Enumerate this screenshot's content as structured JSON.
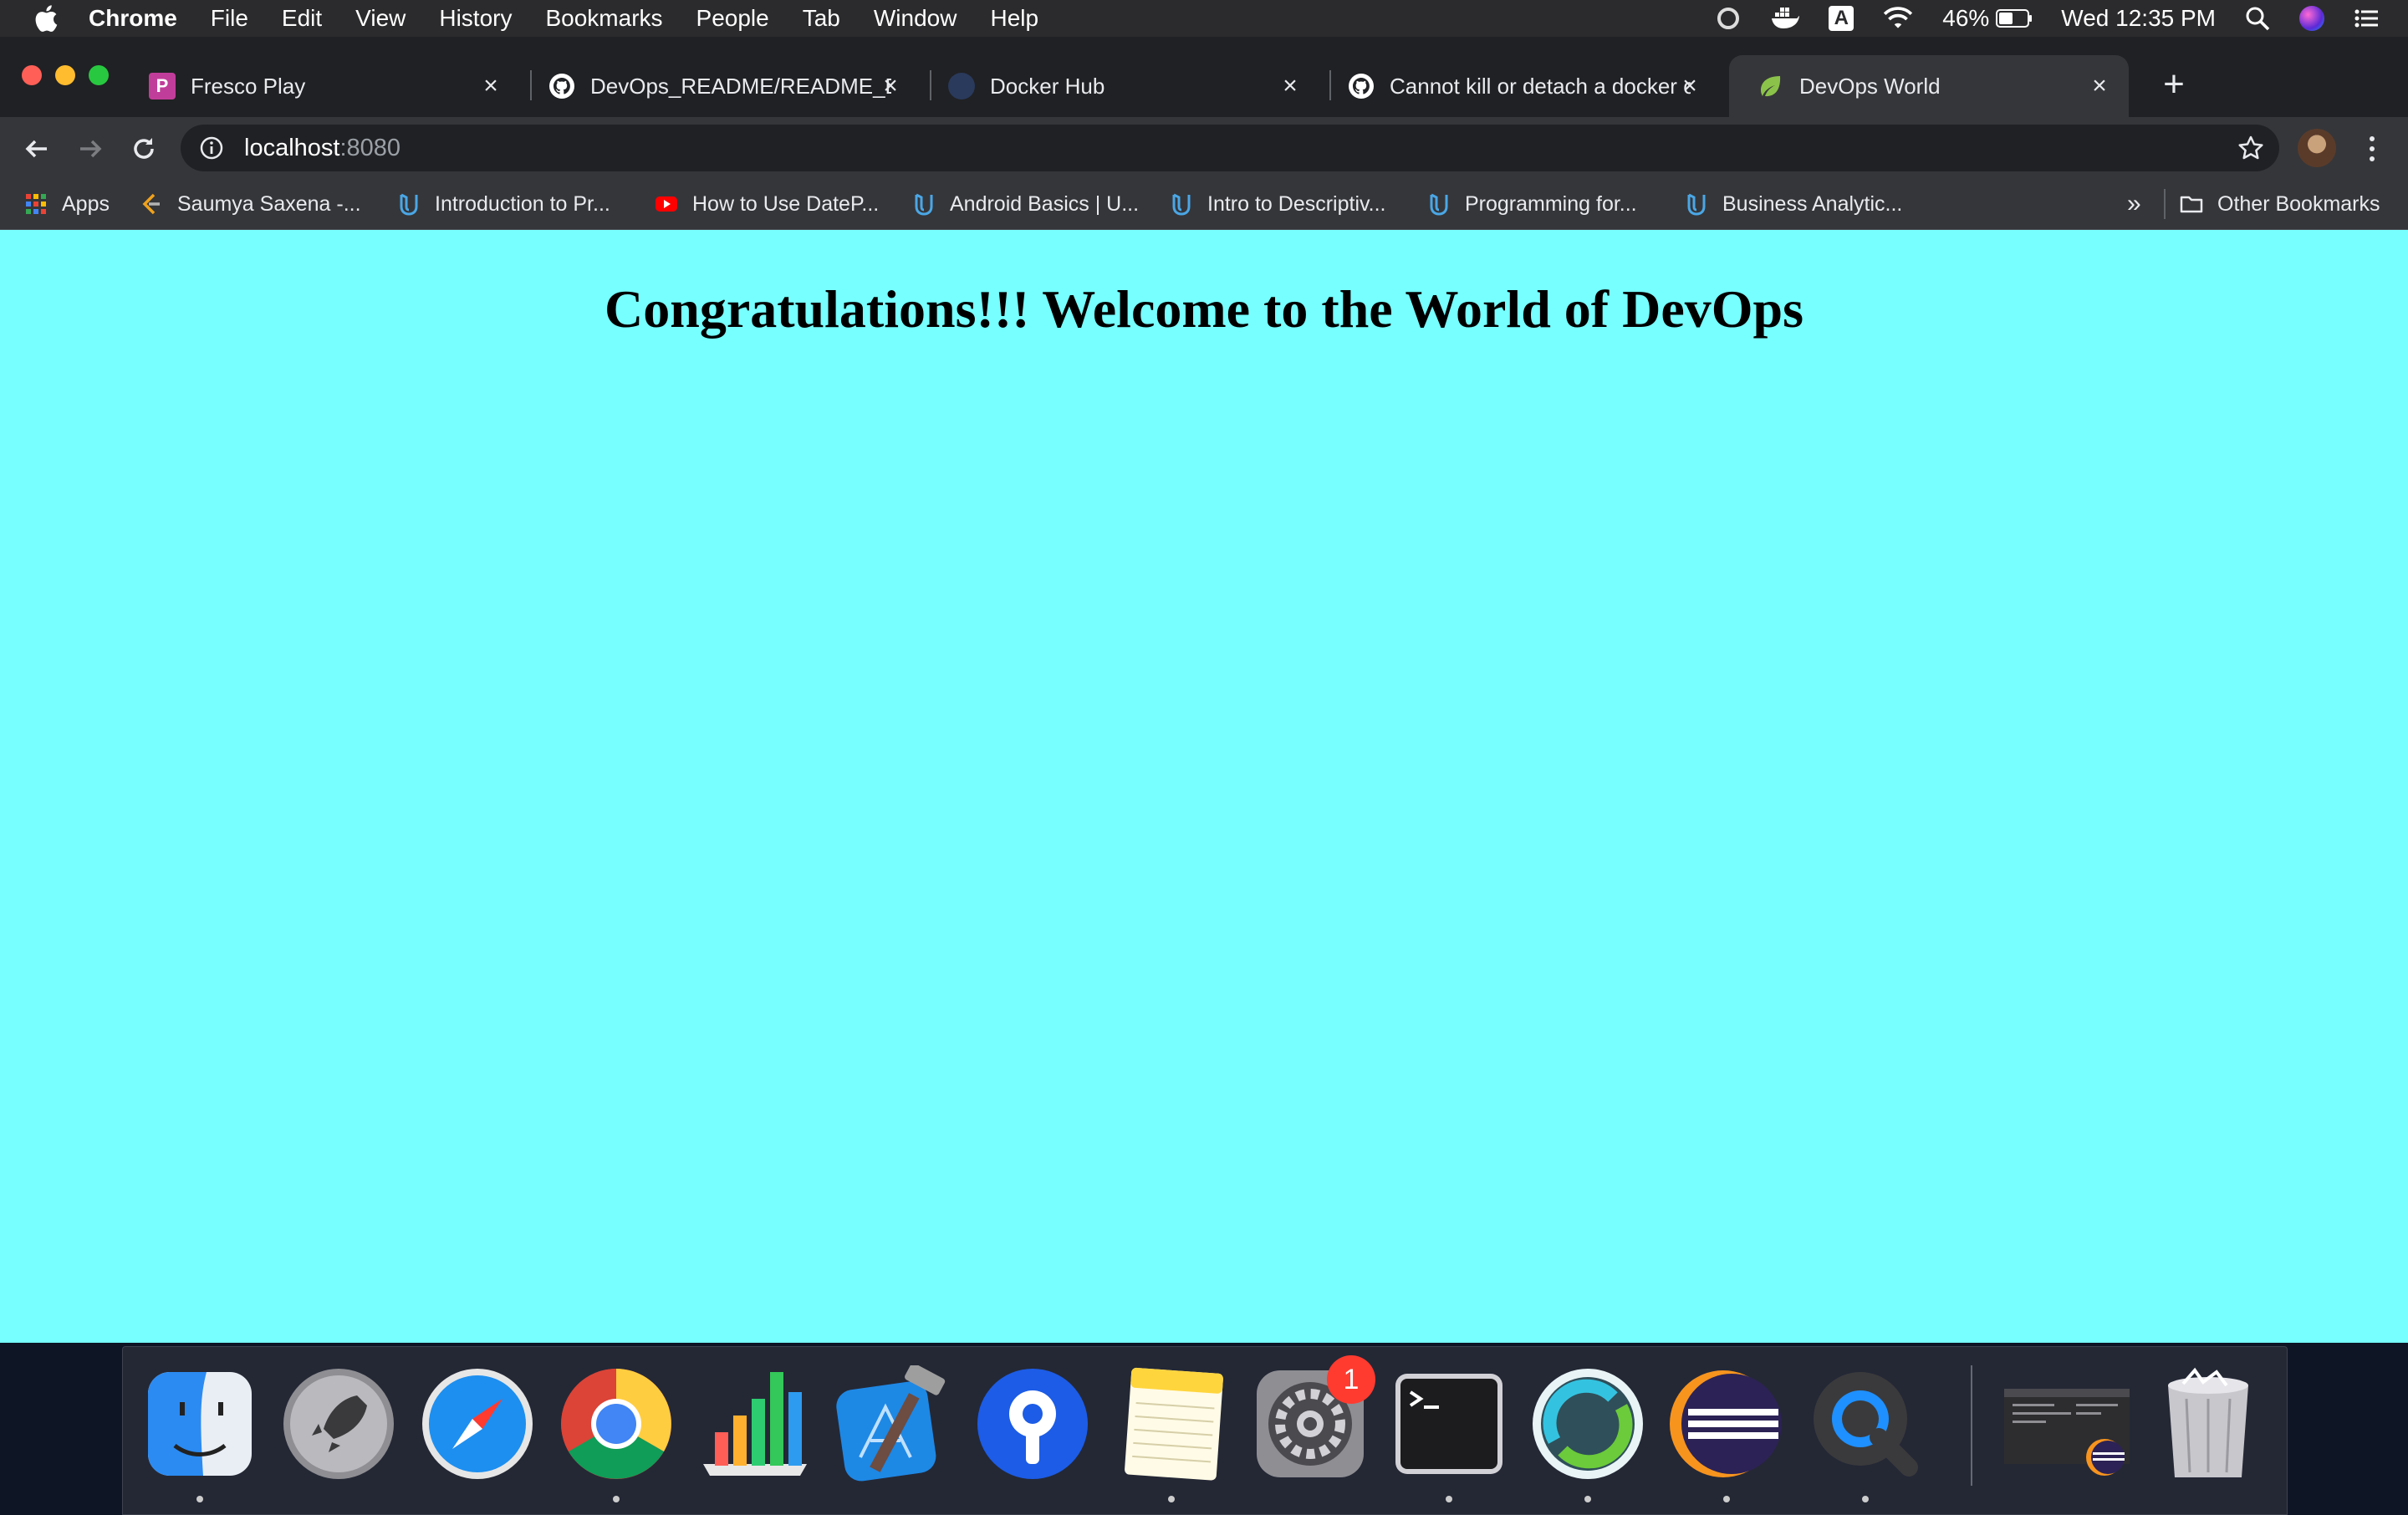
{
  "menubar": {
    "app": "Chrome",
    "items": [
      "File",
      "Edit",
      "View",
      "History",
      "Bookmarks",
      "People",
      "Tab",
      "Window",
      "Help"
    ],
    "battery": "46%",
    "clock": "Wed 12:35 PM",
    "input_source": "A"
  },
  "tabs": [
    {
      "title": "Fresco Play",
      "icon": "fresco-play-icon",
      "active": false
    },
    {
      "title": "DevOps_README/README_Do",
      "icon": "github-icon",
      "active": false
    },
    {
      "title": "Docker Hub",
      "icon": "docker-hub-icon",
      "active": false
    },
    {
      "title": "Cannot kill or detach a docker c",
      "icon": "github-icon",
      "active": false
    },
    {
      "title": "DevOps World",
      "icon": "spring-leaf-icon",
      "active": true
    }
  ],
  "address": {
    "host": "localhost",
    "port": ":8080"
  },
  "bookmarks": [
    {
      "label": "Apps",
      "icon": "apps-grid-icon"
    },
    {
      "label": "Saumya Saxena -...",
      "icon": "leetcode-icon"
    },
    {
      "label": "Introduction to Pr...",
      "icon": "udacity-icon"
    },
    {
      "label": "How to Use DateP...",
      "icon": "youtube-icon"
    },
    {
      "label": "Android Basics | U...",
      "icon": "udacity-icon"
    },
    {
      "label": "Intro to Descriptiv...",
      "icon": "udacity-icon"
    },
    {
      "label": "Programming for...",
      "icon": "udacity-icon"
    },
    {
      "label": "Business Analytic...",
      "icon": "udacity-icon"
    }
  ],
  "bookmarks_overflow": "»",
  "other_bookmarks": "Other Bookmarks",
  "page": {
    "heading": "Congratulations!!! Welcome to the World of DevOps",
    "background": "#77ffff"
  },
  "dock": {
    "apps": [
      "Finder",
      "Launchpad",
      "Safari",
      "Google Chrome",
      "Numbers",
      "Xcode",
      "Sourcetree",
      "Notes",
      "System Preferences",
      "Terminal",
      "Webex",
      "Eclipse",
      "QuickTime Player",
      "Screenshot",
      "Trash"
    ],
    "system_preferences_badge": "1"
  },
  "colors": {
    "accent": "#77ffff",
    "chrome_dark": "#202124",
    "chrome_toolbar": "#35363a"
  }
}
